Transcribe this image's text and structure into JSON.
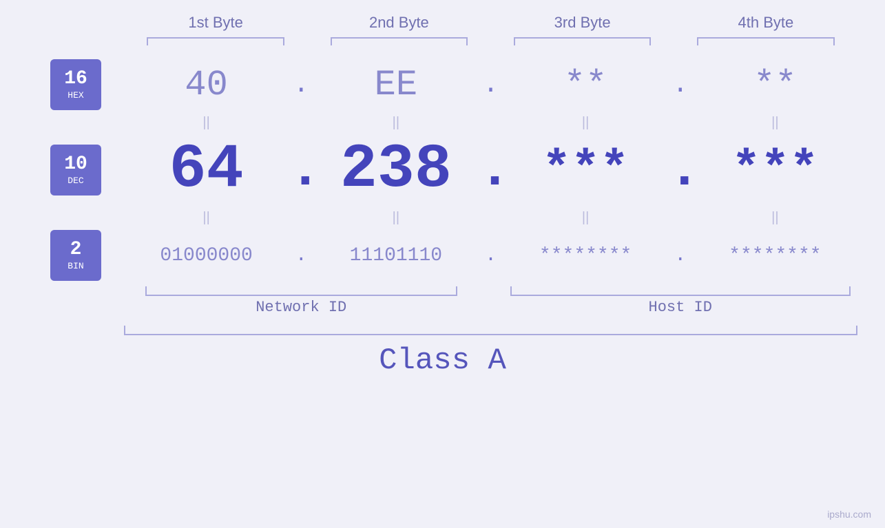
{
  "header": {
    "byte1": "1st Byte",
    "byte2": "2nd Byte",
    "byte3": "3rd Byte",
    "byte4": "4th Byte"
  },
  "badges": {
    "hex": {
      "num": "16",
      "label": "HEX"
    },
    "dec": {
      "num": "10",
      "label": "DEC"
    },
    "bin": {
      "num": "2",
      "label": "BIN"
    }
  },
  "hex_values": {
    "b1": "40",
    "b2": "EE",
    "b3": "**",
    "b4": "**",
    "dot": "."
  },
  "dec_values": {
    "b1": "64",
    "b2": "238",
    "b3": "***",
    "b4": "***",
    "dot": "."
  },
  "bin_values": {
    "b1": "01000000",
    "b2": "11101110",
    "b3": "********",
    "b4": "********",
    "dot": "."
  },
  "labels": {
    "network_id": "Network ID",
    "host_id": "Host ID",
    "class": "Class A"
  },
  "watermark": "ipshu.com"
}
